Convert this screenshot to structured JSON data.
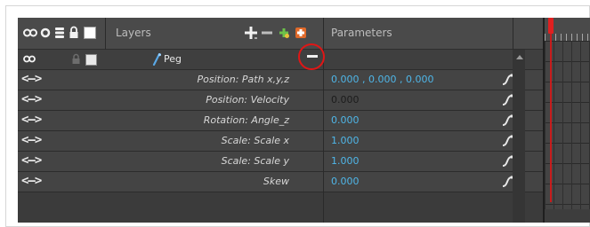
{
  "header": {
    "layers_label": "Layers",
    "parameters_label": "Parameters"
  },
  "layer": {
    "name": "Peg",
    "arrow_glyph": "<—>"
  },
  "rows": [
    {
      "arrows": "<—>",
      "name": "Position: Path x,y,z",
      "value": "0.000 , 0.000 , 0.000"
    },
    {
      "arrows": "<—>",
      "name": "Position: Velocity",
      "value": "0.000"
    },
    {
      "arrows": "<—>",
      "name": "Rotation: Angle_z",
      "value": "0.000"
    },
    {
      "arrows": "<—>",
      "name": "Scale: Scale x",
      "value": "1.000"
    },
    {
      "arrows": "<—>",
      "name": "Scale: Scale y",
      "value": "1.000"
    },
    {
      "arrows": "<—>",
      "name": "Skew",
      "value": "0.000"
    }
  ],
  "colors": {
    "accent_value": "#4fb6e8",
    "playhead": "#e02020",
    "highlight_circle": "#e01616"
  },
  "icons": {
    "header": [
      "eye-icon",
      "circle-icon",
      "layers-icon",
      "lock-icon",
      "color-swatch-icon",
      "add-layer-icon",
      "delete-layer-icon",
      "add-drawing-icon",
      "add-peg-icon"
    ],
    "peg_row": [
      "eye-icon",
      "lock-icon",
      "color-swatch-icon",
      "peg-icon",
      "collapse-minus-icon"
    ],
    "row": [
      "curve-icon"
    ]
  }
}
